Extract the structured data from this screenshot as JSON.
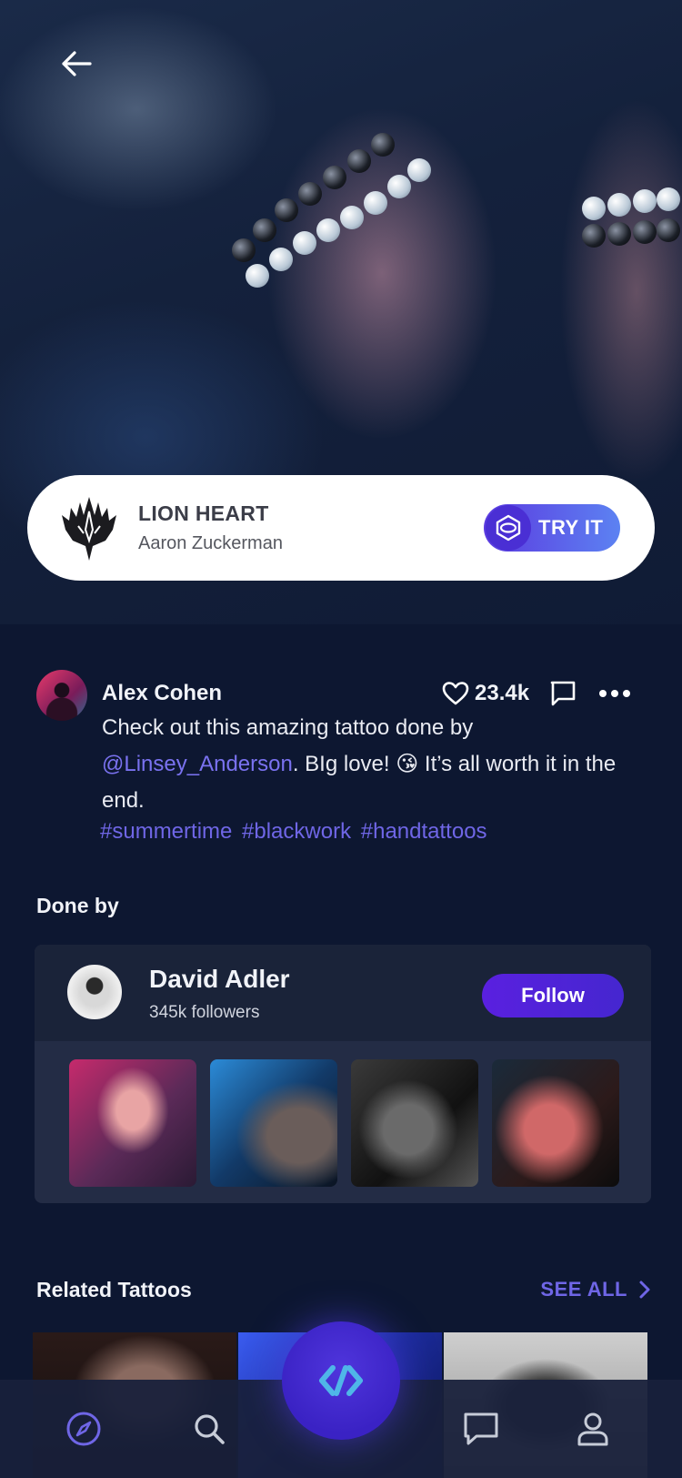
{
  "hero": {
    "design": {
      "title": "LION HEART",
      "artist": "Aaron Zuckerman",
      "try_label": "TRY IT"
    }
  },
  "post": {
    "author": "Alex Cohen",
    "likes": "23.4k",
    "caption_before": "Check out this amazing tattoo done by ",
    "mention": "@Linsey_Anderson",
    "caption_after": ". BIg love! 😘 It’s all worth it in the end.",
    "tags": [
      "#summertime",
      "#blackwork",
      "#handtattoos"
    ]
  },
  "done_by": {
    "title": "Done by",
    "artist_name": "David Adler",
    "followers": "345k followers",
    "follow_label": "Follow"
  },
  "related": {
    "title": "Related Tattoos",
    "see_all": "SEE ALL"
  },
  "tabbar": {
    "items": [
      "compass-icon",
      "search-icon",
      "logo-icon",
      "chat-icon",
      "profile-icon"
    ],
    "active": "compass-icon"
  },
  "colors": {
    "background": "#0d1731",
    "accent": "#6f66e6",
    "button": "#4526cf"
  }
}
